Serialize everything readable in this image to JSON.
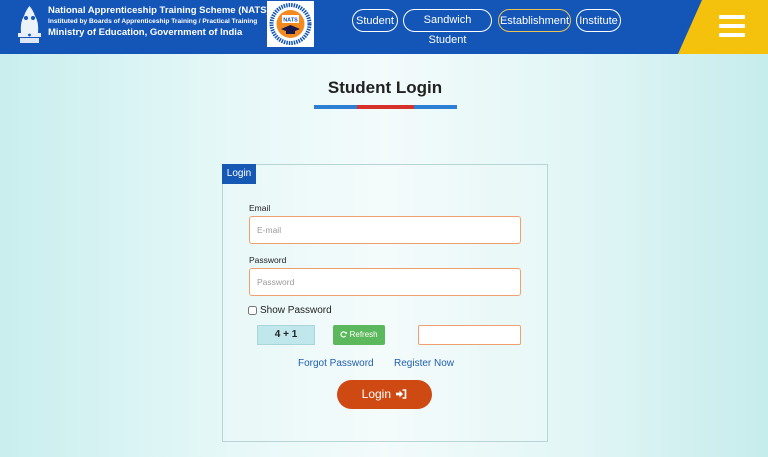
{
  "header": {
    "org_line1": "National Apprenticeship Training Scheme (NATS)",
    "org_line2": "Instituted by Boards of Apprenticeship Training / Practical Training",
    "org_line3": "Ministry of Education, Government of India",
    "logo_text": "NATS",
    "nav": [
      {
        "label": "Student",
        "active": false
      },
      {
        "label": "Sandwich Student",
        "active": false
      },
      {
        "label": "Establishment",
        "active": true
      },
      {
        "label": "Institute",
        "active": false
      }
    ],
    "colors": {
      "bar": "#1456b8",
      "accent": "#f4c20d",
      "active_border": "#e9c35a"
    }
  },
  "page_title": "Student Login",
  "title_bar_colors": [
    "#2d7fd3",
    "#d6312b",
    "#2d7fd3"
  ],
  "login_panel": {
    "tab_label": "Login",
    "email": {
      "label": "Email",
      "placeholder": "E-mail",
      "value": ""
    },
    "password": {
      "label": "Password",
      "placeholder": "Password",
      "value": ""
    },
    "show_password_label": "Show Password",
    "show_password_checked": false,
    "captcha_text": "4 + 1",
    "refresh_label": "Refresh",
    "captcha_answer": "",
    "forgot_password_label": "Forgot Password",
    "register_label": "Register Now",
    "login_label": "Login",
    "colors": {
      "tab": "#1559b4",
      "refresh": "#5cb85c",
      "login": "#cf4a12",
      "input_border": "#f0a070"
    }
  }
}
